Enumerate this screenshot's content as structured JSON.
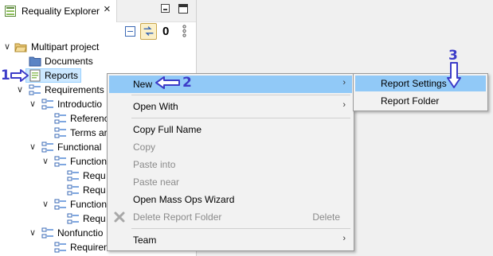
{
  "view": {
    "tab_label": "Requality Explorer",
    "close_glyph": "×",
    "minimize_icon": "minimize-icon",
    "maximize_icon": "maximize-icon"
  },
  "toolbar": {
    "collapse_icon": "collapse-all-icon",
    "link_icon": "link-with-editor-icon",
    "count": "0",
    "more_icon": "view-menu-icon"
  },
  "tree": {
    "items": [
      {
        "label": "Multipart project",
        "icon": "project-folder-icon",
        "expanded": true
      },
      {
        "label": "Documents",
        "icon": "folder-icon"
      },
      {
        "label": "Reports",
        "icon": "report-folder-icon",
        "selected": true
      },
      {
        "label": "Requirements",
        "icon": "requirement-icon",
        "expanded": true
      },
      {
        "label": "Introductio",
        "icon": "requirement-icon",
        "expanded": true
      },
      {
        "label": "Referenc",
        "icon": "requirement-icon"
      },
      {
        "label": "Terms ar",
        "icon": "requirement-icon"
      },
      {
        "label": "Functional",
        "icon": "requirement-icon",
        "expanded": true
      },
      {
        "label": "Function",
        "icon": "requirement-icon",
        "expanded": true
      },
      {
        "label": "Requ",
        "icon": "requirement-icon"
      },
      {
        "label": "Requ",
        "icon": "requirement-icon"
      },
      {
        "label": "Function",
        "icon": "requirement-icon",
        "expanded": true
      },
      {
        "label": "Requ",
        "icon": "requirement-icon"
      },
      {
        "label": "Nonfunctio",
        "icon": "requirement-icon",
        "expanded": true
      },
      {
        "label": "Requiren",
        "icon": "requirement-icon"
      }
    ]
  },
  "context_menu": {
    "items": [
      {
        "label": "New",
        "submenu": true,
        "highlight": true
      },
      {
        "label": "Open With",
        "submenu": true
      },
      {
        "label": "Copy Full Name"
      },
      {
        "label": "Copy",
        "disabled": true
      },
      {
        "label": "Paste into",
        "disabled": true
      },
      {
        "label": "Paste near",
        "disabled": true
      },
      {
        "label": "Open Mass Ops Wizard"
      },
      {
        "label": "Delete Report Folder",
        "disabled": true,
        "shortcut": "Delete",
        "icon": "delete-icon"
      },
      {
        "label": "Team",
        "submenu": true
      }
    ],
    "arrow_glyph": "›"
  },
  "submenu": {
    "items": [
      {
        "label": "Report Settings",
        "highlight": true
      },
      {
        "label": "Report Folder"
      }
    ]
  },
  "annotations": {
    "step1": "1",
    "step2": "2",
    "step3": "3",
    "color": "#3c3cc8"
  },
  "colors": {
    "menu_highlight": "#91c9f7",
    "selection": "#cce8ff",
    "disabled_text": "#8a8a8a"
  }
}
